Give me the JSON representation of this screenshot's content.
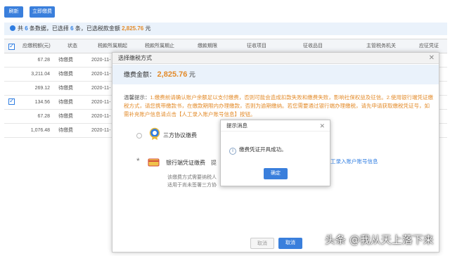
{
  "toolbar": {
    "refresh_label": "刷新",
    "pay_now_label": "立即缴费"
  },
  "summary": {
    "prefix": "共",
    "total_count": "6",
    "mid1": "条数据，已选择",
    "selected_count": "6",
    "mid2": "条，已选税款金额",
    "amount": "2,825.76",
    "suffix": "元"
  },
  "table": {
    "headers": [
      "应缴税额(元)",
      "状态",
      "税款所属期起",
      "税款所属期止",
      "缴款期限",
      "征收项目",
      "征收品目",
      "主管税务机关",
      "应征凭证"
    ],
    "rows": [
      {
        "amount": "67.28",
        "status": "待缴费",
        "date": "2020-11-"
      },
      {
        "amount": "3,211.04",
        "status": "待缴费",
        "date": "2020-11-"
      },
      {
        "amount": "269.12",
        "status": "待缴费",
        "date": "2020-11-"
      },
      {
        "amount": "134.56",
        "status": "待缴费",
        "date": "2020-11-"
      },
      {
        "amount": "67.28",
        "status": "待缴费",
        "date": "2020-11-"
      },
      {
        "amount": "1,076.48",
        "status": "待缴费",
        "date": "2020-11-"
      }
    ]
  },
  "modal": {
    "title": "选择缴税方式",
    "amount_label": "缴费金额：",
    "amount": "2,825.76",
    "amount_unit": "元",
    "notice_label": "温馨提示：",
    "notice_text": "1.缴费前请确认账户余额足以支付缴费，否则可能会造成扣款失败和缴费失败，影响社保权益及征信。2.使用银行端凭证缴税方式，请您携带缴款书，在缴款期限内办理缴款，否则为逾期缴纳。若您需要通过银行端办理缴税，请先申请获取缴税凭证号，如需补充账户信息请点击【人工录入账户账号信息】按钮。",
    "opt1_title": "三方协议缴费",
    "opt2_title": "银行端凭证缴费",
    "opt2_note_line1": "该缴费方式需要纳税人",
    "opt2_note_line2": "适用于尚未签署三方协",
    "opt2_link": "工录入账户账号信息",
    "opt2_prefix": "提",
    "cancel_label": "取消",
    "confirm_label": "取消"
  },
  "dialog": {
    "title": "提示消息",
    "message": "缴费凭证开具成功。",
    "ok_label": "确定"
  },
  "watermark": "头条 @我从天上落下来",
  "colors": {
    "primary": "#3a7fdc",
    "accent": "#e38b2a",
    "info_bg": "#eaf2fb"
  }
}
